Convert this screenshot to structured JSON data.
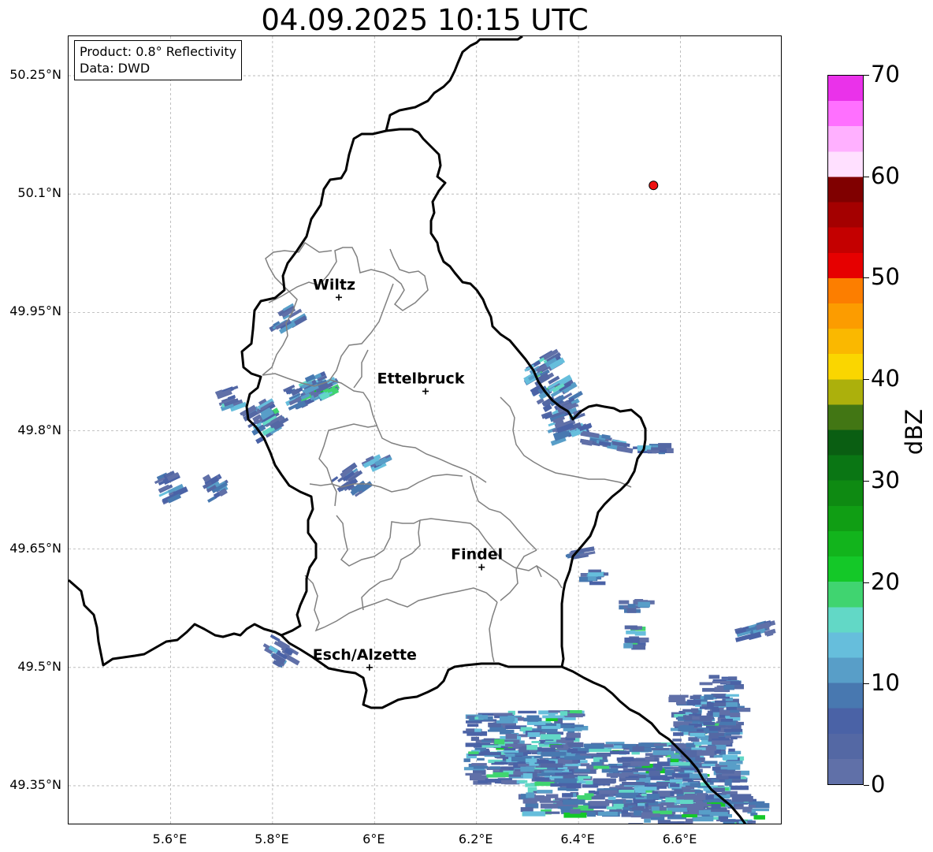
{
  "title": "04.09.2025 10:15 UTC",
  "info": {
    "product": "Product: 0.8° Reflectivity",
    "source": "Data: DWD"
  },
  "axes": {
    "lat_ticks": [
      "50.25°N",
      "50.1°N",
      "49.95°N",
      "49.8°N",
      "49.65°N",
      "49.5°N",
      "49.35°N"
    ],
    "lon_ticks": [
      "5.6°E",
      "5.8°E",
      "6°E",
      "6.2°E",
      "6.4°E",
      "6.6°E"
    ],
    "lon_range": [
      5.4,
      6.8
    ],
    "lat_range": [
      49.3,
      50.3
    ]
  },
  "cities": [
    {
      "name": "Wiltz",
      "lon": 5.93,
      "lat": 49.969
    },
    {
      "name": "Ettelbruck",
      "lon": 6.1,
      "lat": 49.85
    },
    {
      "name": "Findel",
      "lon": 6.21,
      "lat": 49.627
    },
    {
      "name": "Esch/Alzette",
      "lon": 5.99,
      "lat": 49.5
    }
  ],
  "radar_site": {
    "lon": 6.547,
    "lat": 50.111,
    "color": "#ee1111"
  },
  "colorbar": {
    "label": "dBZ",
    "min": 0,
    "max": 70,
    "tick_labels": [
      "0",
      "10",
      "20",
      "30",
      "40",
      "50",
      "60",
      "70"
    ],
    "colors": [
      "#6070a8",
      "#5468a4",
      "#4a62a6",
      "#4878b0",
      "#589ec8",
      "#66bedc",
      "#62d8c6",
      "#40d470",
      "#14c828",
      "#12b41c",
      "#109e14",
      "#0e8a12",
      "#0a7614",
      "#0a5e12",
      "#427614",
      "#acb00c",
      "#fad600",
      "#fab800",
      "#fc9c00",
      "#fc7e00",
      "#e60000",
      "#c40000",
      "#a40000",
      "#800000",
      "#ffe0ff",
      "#ffb0ff",
      "#ff70ff",
      "#ea32ea"
    ]
  },
  "legend_colors": {
    "border_national": "#000000",
    "border_cantonal": "#808080",
    "grid": "#b0b0b0"
  }
}
